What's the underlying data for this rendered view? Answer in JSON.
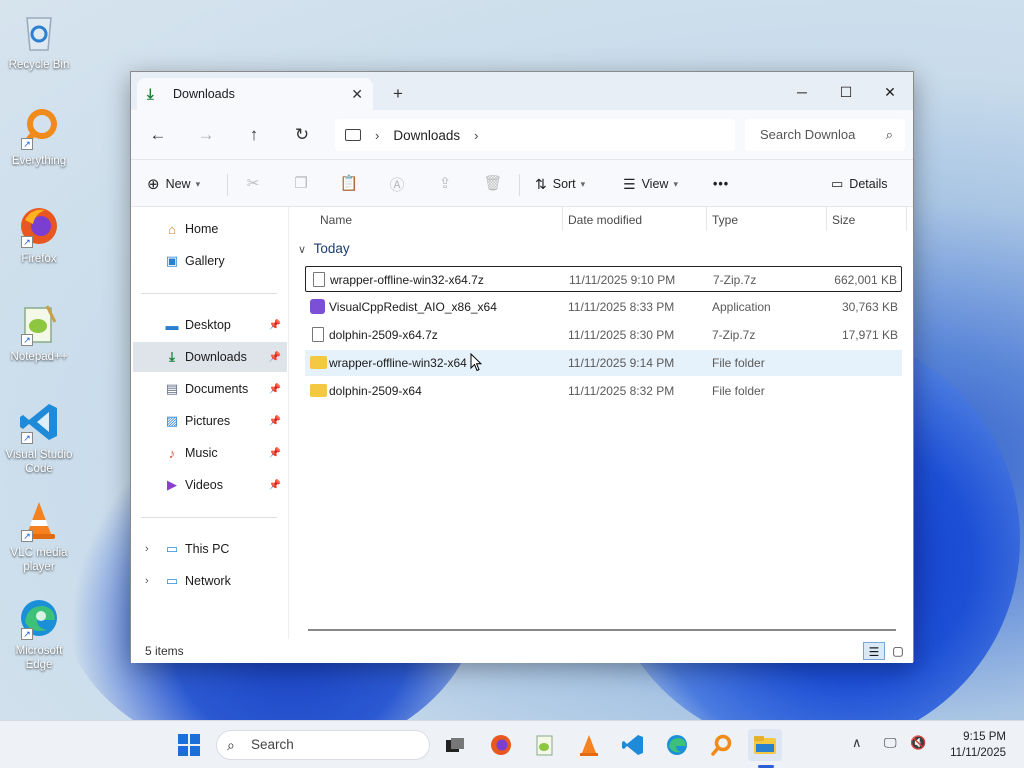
{
  "desktop": {
    "icons": [
      {
        "label": "Recycle Bin",
        "icon": "recycle-bin-icon"
      },
      {
        "label": "Everything",
        "icon": "magnifier-icon"
      },
      {
        "label": "Firefox",
        "icon": "firefox-icon"
      },
      {
        "label": "Notepad++",
        "icon": "notepad-plus-plus-icon"
      },
      {
        "label": "Visual Studio Code",
        "icon": "vscode-icon"
      },
      {
        "label": "VLC media player",
        "icon": "vlc-icon"
      },
      {
        "label": "Microsoft Edge",
        "icon": "edge-icon"
      }
    ]
  },
  "window": {
    "tab_title": "Downloads",
    "nav": {
      "breadcrumb": "Downloads",
      "search_placeholder": "Search Downloa"
    },
    "toolbar": {
      "new_label": "New",
      "sort_label": "Sort",
      "view_label": "View",
      "more_label": "•••",
      "details_label": "Details"
    },
    "sidebar": {
      "home": "Home",
      "gallery": "Gallery",
      "desktop": "Desktop",
      "downloads": "Downloads",
      "documents": "Documents",
      "pictures": "Pictures",
      "music": "Music",
      "videos": "Videos",
      "this_pc": "This PC",
      "network": "Network"
    },
    "columns": {
      "name": "Name",
      "date": "Date modified",
      "type": "Type",
      "size": "Size"
    },
    "group_label": "Today",
    "files": [
      {
        "name": "wrapper-offline-win32-x64.7z",
        "date": "11/11/2025 9:10 PM",
        "type": "7-Zip.7z",
        "size": "662,001 KB",
        "kind": "file"
      },
      {
        "name": "VisualCppRedist_AIO_x86_x64",
        "date": "11/11/2025 8:33 PM",
        "type": "Application",
        "size": "30,763 KB",
        "kind": "app"
      },
      {
        "name": "dolphin-2509-x64.7z",
        "date": "11/11/2025 8:30 PM",
        "type": "7-Zip.7z",
        "size": "17,971 KB",
        "kind": "file"
      },
      {
        "name": "wrapper-offline-win32-x64",
        "date": "11/11/2025 9:14 PM",
        "type": "File folder",
        "size": "",
        "kind": "folder"
      },
      {
        "name": "dolphin-2509-x64",
        "date": "11/11/2025 8:32 PM",
        "type": "File folder",
        "size": "",
        "kind": "folder"
      }
    ],
    "status": "5 items"
  },
  "taskbar": {
    "search_label": "Search",
    "time": "9:15 PM",
    "date": "11/11/2025"
  }
}
